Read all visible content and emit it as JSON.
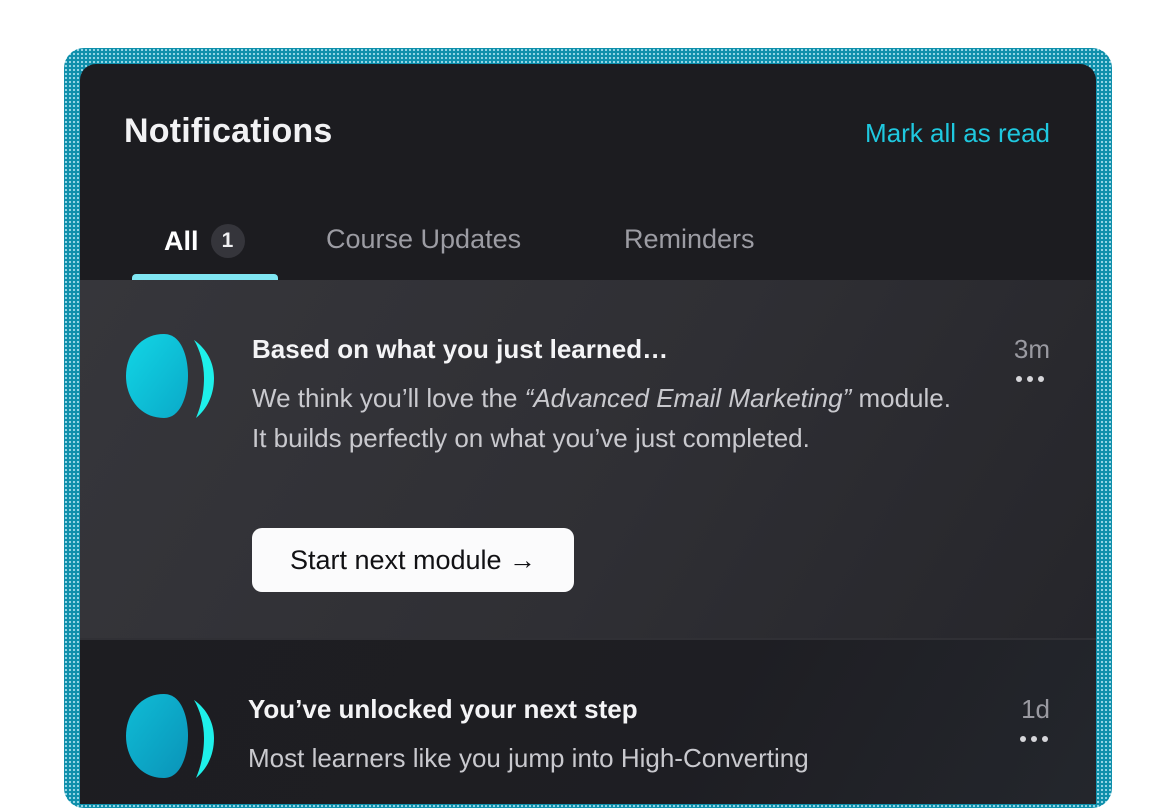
{
  "header": {
    "title": "Notifications",
    "mark_all_label": "Mark all as read"
  },
  "tabs": [
    {
      "label": "All",
      "badge": "1",
      "active": true
    },
    {
      "label": "Course Updates",
      "active": false
    },
    {
      "label": "Reminders",
      "active": false
    }
  ],
  "notifications": [
    {
      "title": "Based on what you just learned…",
      "body_before": "We think you’ll love the ",
      "body_emphasis": "“Advanced Email Marketing”",
      "body_after": " module. It builds perfectly on what you’ve just completed.",
      "time": "3m",
      "menu_icon": "more-horizontal-icon",
      "action_label": "Start next module →"
    },
    {
      "title": "You’ve unlocked your next step",
      "body": "Most learners like you jump into High-Converting",
      "time": "1d",
      "menu_icon": "more-horizontal-icon"
    }
  ],
  "colors": {
    "accent": "#1fc8df",
    "tab_indicator": "#7fe6f2",
    "panel_bg": "#1c1c20",
    "frame": "#0e8fab"
  },
  "logo_icon": "brand-logo-icon"
}
